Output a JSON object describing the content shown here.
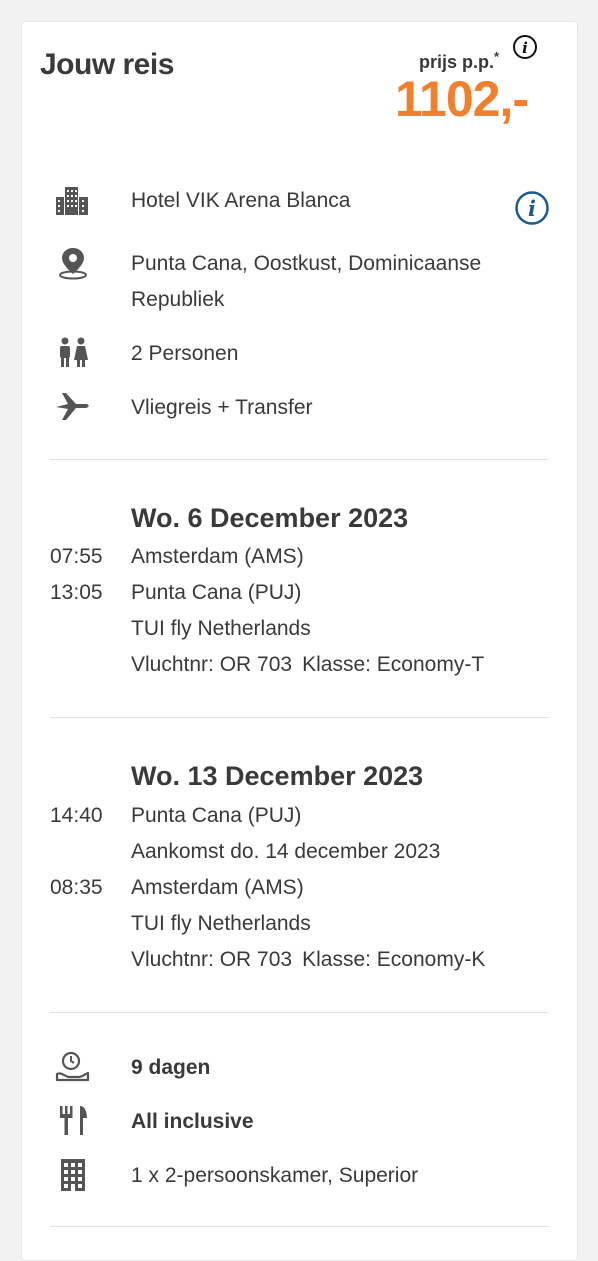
{
  "header": {
    "title": "Jouw reis",
    "price_label": "prijs p.p.",
    "price_asterisk": "*",
    "price": "1102,-"
  },
  "trip": {
    "hotel": "Hotel VIK Arena Blanca",
    "location_line1": "Punta Cana, Oostkust, Dominicaanse",
    "location_line2": "Republiek",
    "persons": "2 Personen",
    "travel_type": "Vliegreis + Transfer"
  },
  "outbound": {
    "date": "Wo. 6 December 2023",
    "dep_time": "07:55",
    "dep_airport": "Amsterdam (AMS)",
    "arr_time": "13:05",
    "arr_airport": "Punta Cana (PUJ)",
    "carrier": "TUI fly Netherlands",
    "flight_no": "Vluchtnr: OR 703",
    "class": "Klasse: Economy-T"
  },
  "return": {
    "date": "Wo. 13 December 2023",
    "dep_time": "14:40",
    "dep_airport": "Punta Cana (PUJ)",
    "arrival_note": "Aankomst do. 14 december 2023",
    "arr_time": "08:35",
    "arr_airport": "Amsterdam (AMS)",
    "carrier": "TUI fly Netherlands",
    "flight_no": "Vluchtnr: OR 703",
    "class": "Klasse: Economy-K"
  },
  "stay": {
    "duration": "9 dagen",
    "board": "All inclusive",
    "room": "1 x 2-persoonskamer, Superior"
  },
  "colors": {
    "accent_price": "#f0802e",
    "info_blue": "#1d5a8c",
    "text": "#3a3a3a",
    "icon": "#555555"
  },
  "icons": [
    "info-icon",
    "hotel-building-icon",
    "location-pin-icon",
    "persons-icon",
    "airplane-icon",
    "duration-icon",
    "cutlery-icon",
    "room-building-icon"
  ]
}
